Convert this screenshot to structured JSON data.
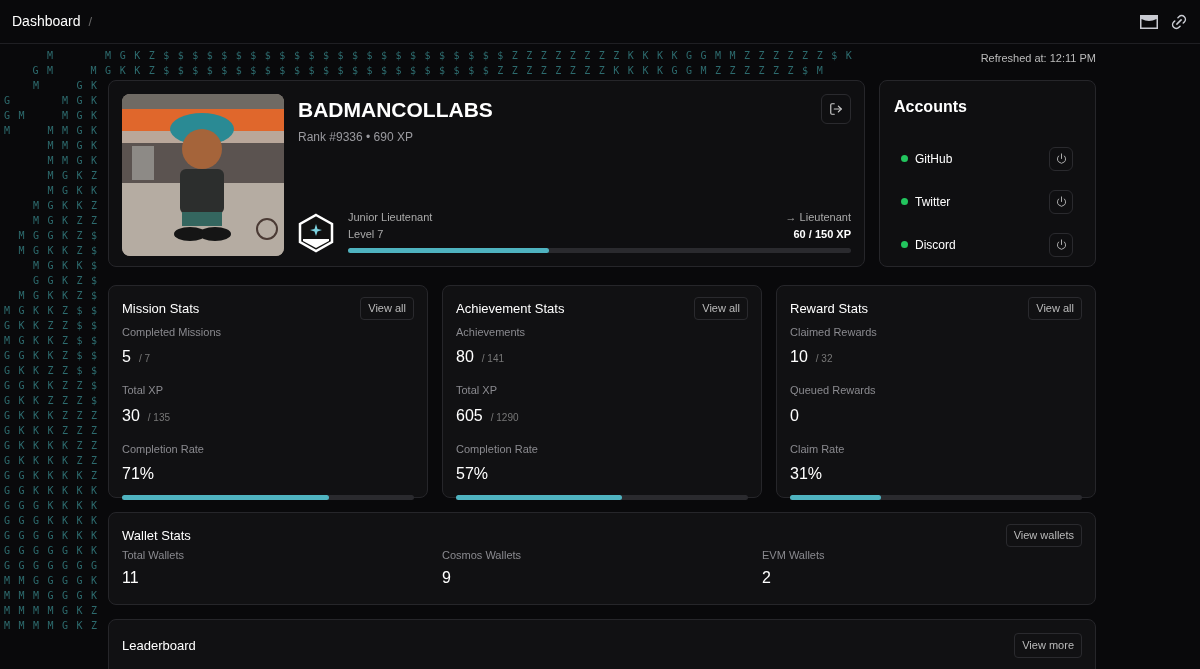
{
  "breadcrumb": {
    "items": [
      "Dashboard"
    ],
    "separator": "/"
  },
  "rain": {
    "top_rows": [
      "  M   MGKZ$$$$$$$$$$$$$$$$$$$$$$$$ZZZZZZZZKKKKGGMMZZZZZZ$K",
      " GM  MGKKZ$$$$$$$$$$$$$$$$$$$$$$$ZZZZZZZZKKKKGGMZZZZZZ$M"
    ],
    "side_rows": [
      "  M  GK",
      "G   MGK",
      "GM  MGK",
      "M  MMGK",
      "   MMGK",
      "   MMGK",
      "   MGKZ",
      "   MGKK",
      "  MGKKZ",
      "  MGKZZ",
      " MGGKZ$",
      " MGKKZ$",
      "  MGKK$",
      "  GGKZ$",
      " MGKKZ$",
      "MGKKZ$$",
      "GKKZZ$$",
      "MGKKZ$$",
      "GGKKZ$$",
      "GKKZZ$$",
      "GGKKZZ$",
      "GKKZZZ$",
      "GKKKZZZ",
      "GKKKZZZ",
      "GKKKKZZ",
      "GKKKKZZ",
      "GGKKKKZ",
      "GGKKKKK",
      "GGGKKKK",
      "GGGKKKK",
      "GGGGKKK",
      "GGGGGKK",
      "GGGGGGG",
      "MMGGGGK",
      "MMMGGGK",
      "MMMMGKZ",
      "MMMMGKZ"
    ]
  },
  "refreshed": "Refreshed at: 12:11 PM",
  "profile": {
    "name": "BADMANCOLLABS",
    "rank": "Rank #9336 • 690 XP",
    "rank_title": "Junior Lieutenant",
    "level": "Level 7",
    "next": "→ Lieutenant",
    "xp": "60 / 150 XP",
    "progress": {
      "level": 0.4
    }
  },
  "accounts": {
    "title": "Accounts",
    "items": [
      {
        "name": "GitHub",
        "color": "#22c55e"
      },
      {
        "name": "Twitter",
        "color": "#22c55e"
      },
      {
        "name": "Discord",
        "color": "#22c55e"
      }
    ]
  },
  "stat_cards": [
    {
      "title": "Mission Stats",
      "button": "View all",
      "items": [
        {
          "kind": "count",
          "label": "Completed Missions",
          "value": "5",
          "total": "/ 7"
        },
        {
          "kind": "count",
          "label": "Total XP",
          "value": "30",
          "total": "/ 135"
        },
        {
          "kind": "rate",
          "label": "Completion Rate",
          "value": "71%",
          "level": 0.71
        }
      ]
    },
    {
      "title": "Achievement Stats",
      "button": "View all",
      "items": [
        {
          "kind": "count",
          "label": "Achievements",
          "value": "80",
          "total": "/ 141"
        },
        {
          "kind": "count",
          "label": "Total XP",
          "value": "605",
          "total": "/ 1290"
        },
        {
          "kind": "rate",
          "label": "Completion Rate",
          "value": "57%",
          "level": 0.57
        }
      ]
    },
    {
      "title": "Reward Stats",
      "button": "View all",
      "items": [
        {
          "kind": "count",
          "label": "Claimed Rewards",
          "value": "10",
          "total": "/ 32"
        },
        {
          "kind": "count",
          "label": "Queued Rewards",
          "value": "0"
        },
        {
          "kind": "rate",
          "label": "Claim Rate",
          "value": "31%",
          "level": 0.31
        }
      ]
    }
  ],
  "wallet_stats": {
    "title": "Wallet Stats",
    "button": "View wallets",
    "items": [
      {
        "label": "Total Wallets",
        "value": "11"
      },
      {
        "label": "Cosmos Wallets",
        "value": "9"
      },
      {
        "label": "EVM Wallets",
        "value": "2"
      }
    ]
  },
  "leaderboard": {
    "title": "Leaderboard",
    "button": "View more"
  }
}
